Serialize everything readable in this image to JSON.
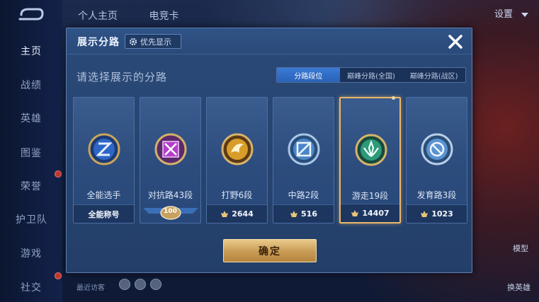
{
  "background": {
    "nav_items": [
      "主页",
      "战绩",
      "英雄",
      "图鉴",
      "荣誉",
      "护卫队",
      "游戏",
      "社交"
    ],
    "top_tabs": [
      "个人主页",
      "电竞卡"
    ],
    "settings_label": "设置",
    "right_labels": [
      "模型",
      "换英雄"
    ],
    "recent_visitors_label": "最近访客"
  },
  "modal": {
    "title": "展示分路",
    "priority_button": "优先显示",
    "subtitle": "请选择展示的分路",
    "segments": [
      "分路段位",
      "巅峰分路(全国)",
      "巅峰分路(战区)"
    ],
    "active_segment": 0,
    "cards": [
      {
        "label": "全能选手",
        "footer": "全能称号",
        "icon": "all-round-emblem-icon",
        "selected": false
      },
      {
        "label": "对抗路43段",
        "footer": "100",
        "icon": "clash-lane-emblem-icon",
        "selected": false
      },
      {
        "label": "打野6段",
        "footer": "2644",
        "icon": "jungle-emblem-icon",
        "selected": false
      },
      {
        "label": "中路2段",
        "footer": "516",
        "icon": "mid-lane-emblem-icon",
        "selected": false
      },
      {
        "label": "游走19段",
        "footer": "14407",
        "icon": "roam-emblem-icon",
        "selected": true
      },
      {
        "label": "发育路3段",
        "footer": "1023",
        "icon": "farm-lane-emblem-icon",
        "selected": false
      }
    ],
    "confirm_button": "确定"
  },
  "colors": {
    "selected_border": "#e8b86a",
    "active_segment": "#2a62b8",
    "confirm_gold": "#c89b55"
  }
}
